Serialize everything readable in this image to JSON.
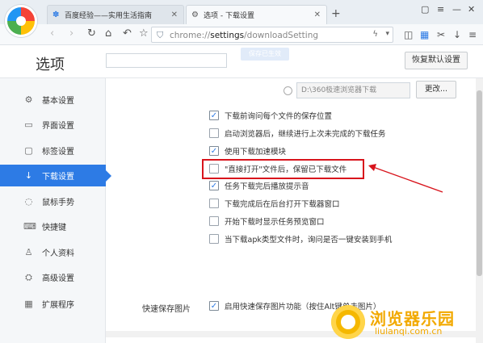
{
  "browser": {
    "tabs": [
      {
        "title": "百度经验——实用生活指南",
        "favicon": "paw-icon",
        "active": false
      },
      {
        "title": "选项 - 下载设置",
        "favicon": "gear-icon",
        "active": true
      }
    ],
    "new_tab": "+",
    "address": {
      "scheme": "chrome://",
      "host": "settings",
      "path": "/downloadSetting"
    }
  },
  "header": {
    "title": "选项",
    "faint_button": "保存已生效",
    "reset_label": "恢复默认设置"
  },
  "sidebar": {
    "items": [
      {
        "label": "基本设置",
        "icon": "gear-icon",
        "glyph": "⚙"
      },
      {
        "label": "界面设置",
        "icon": "window-icon",
        "glyph": "▭"
      },
      {
        "label": "标签设置",
        "icon": "tabs-icon",
        "glyph": "▢"
      },
      {
        "label": "下载设置",
        "icon": "download-icon",
        "glyph": "↓",
        "active": true
      },
      {
        "label": "鼠标手势",
        "icon": "mouse-icon",
        "glyph": "◌"
      },
      {
        "label": "快捷键",
        "icon": "keyboard-icon",
        "glyph": "⌨"
      },
      {
        "label": "个人资料",
        "icon": "person-icon",
        "glyph": "♙"
      },
      {
        "label": "高级设置",
        "icon": "advanced-icon",
        "glyph": "⛭"
      },
      {
        "label": "扩展程序",
        "icon": "extension-icon",
        "glyph": "▦"
      }
    ]
  },
  "download": {
    "path_value": "D:\\360极速浏览器下载",
    "change_label": "更改...",
    "options": [
      {
        "label": "下载前询问每个文件的保存位置",
        "checked": true
      },
      {
        "label": "启动浏览器后，继续进行上次未完成的下载任务",
        "checked": false
      },
      {
        "label": "使用下载加速模块",
        "checked": true
      },
      {
        "label": "\"直接打开\"文件后，保留已下载文件",
        "checked": false
      },
      {
        "label": "任务下载完后播放提示音",
        "checked": true
      },
      {
        "label": "下载完成后在后台打开下载器窗口",
        "checked": false
      },
      {
        "label": "开始下载时显示任务预览窗口",
        "checked": false
      },
      {
        "label": "当下载apk类型文件时，询问是否一键安装到手机",
        "checked": false
      }
    ]
  },
  "quick_save": {
    "section_label": "快速保存图片",
    "option_label": "启用快速保存图片功能（按住Alt键单击图片）",
    "checked": true
  },
  "watermark": {
    "text": "浏览器乐园",
    "url": "liulanqi.com.cn"
  },
  "colors": {
    "accent": "#2d7be5",
    "highlight": "#d8141c",
    "watermark": "#f2a900"
  }
}
